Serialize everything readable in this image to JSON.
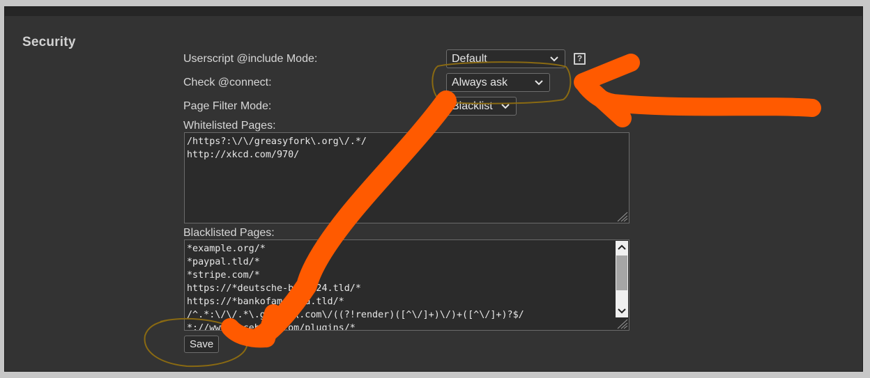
{
  "section": {
    "title": "Security"
  },
  "rows": {
    "include_mode": {
      "label": "Userscript @include Mode:",
      "value": "Default"
    },
    "check_connect": {
      "label": "Check @connect:",
      "value": "Always ask"
    },
    "filter_mode": {
      "label": "Page Filter Mode:",
      "value": "Blacklist"
    }
  },
  "help": {
    "glyph": "?",
    "icon": "help-icon"
  },
  "whitelist": {
    "label": "Whitelisted Pages:",
    "lines": [
      "/https?:\\/\\/greasyfork\\.org\\/.*/",
      "http://xkcd.com/970/"
    ]
  },
  "blacklist": {
    "label": "Blacklisted Pages:",
    "lines": [
      "*example.org/*",
      "*paypal.tld/*",
      "*stripe.com/*",
      "https://*deutsche-bank-24.tld/*",
      "https://*bankofamerica.tld/*",
      "/^.*:\\/\\/.*\\.google\\.com\\/((?!render)([^\\/]+)\\/)+([^\\/]+)?$/",
      "*://www.facebook.com/plugins/*"
    ]
  },
  "save": {
    "label": "Save"
  },
  "colors": {
    "background": "#333333",
    "annotation_arrow": "#ff5a00",
    "annotation_circle": "#8a6a12"
  }
}
